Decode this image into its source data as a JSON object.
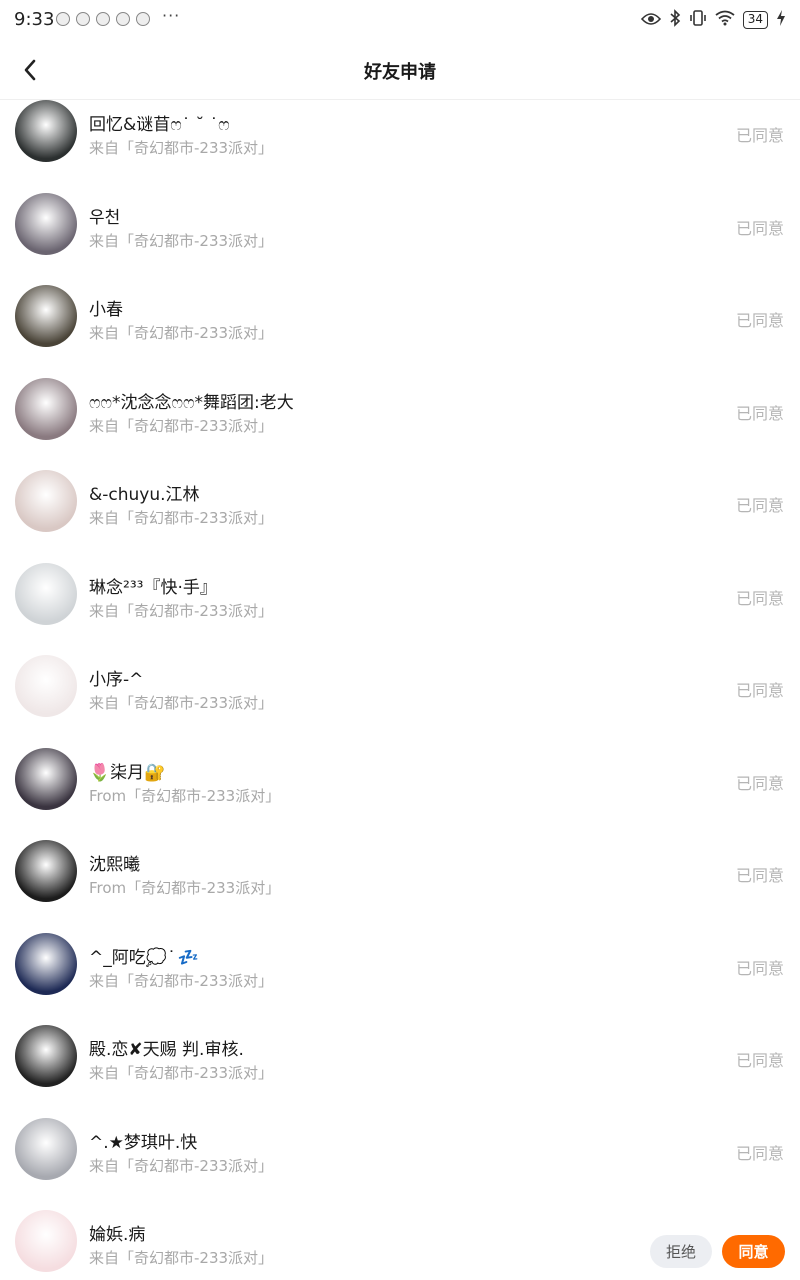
{
  "status_bar": {
    "time": "9:33",
    "more": "···",
    "battery": "34"
  },
  "header": {
    "title": "好友申请"
  },
  "requests": [
    {
      "name": "回忆&谜苜ෆ˙ ˘ ˙ෆ",
      "source": "来自「奇幻都市-233派对」",
      "status": "已同意",
      "avatar": "#2b2f2f"
    },
    {
      "name": "우천",
      "source": "来自「奇幻都市-233派对」",
      "status": "已同意",
      "avatar": "#6a6470"
    },
    {
      "name": "小春",
      "source": "来自「奇幻都市-233派对」",
      "status": "已同意",
      "avatar": "#4a4438"
    },
    {
      "name": "ෆෆ*沈念念ෆෆ*舞蹈团:老大",
      "source": "来自「奇幻都市-233派对」",
      "status": "已同意",
      "avatar": "#8a7a80"
    },
    {
      "name": "&-chuyu.江林",
      "source": "来自「奇幻都市-233派对」",
      "status": "已同意",
      "avatar": "#d9c8c4"
    },
    {
      "name": "琳念²³³『快·手』",
      "source": "来自「奇幻都市-233派对」",
      "status": "已同意",
      "avatar": "#cfd3d6"
    },
    {
      "name": "小序-^",
      "source": "来自「奇幻都市-233派对」",
      "status": "已同意",
      "avatar": "#efe7e7"
    },
    {
      "name": "🌷柒月🔐",
      "source": "From「奇幻都市-233派对」",
      "status": "已同意",
      "avatar": "#3a3440"
    },
    {
      "name": "沈熙曦",
      "source": "From「奇幻都市-233派对」",
      "status": "已同意",
      "avatar": "#1c1c1c"
    },
    {
      "name": "^_阿吃💭 ͘ 💤",
      "source": "来自「奇幻都市-233派对」",
      "status": "已同意",
      "avatar": "#1e2a55"
    },
    {
      "name": "殿.恋✘天赐 判.审核.",
      "source": "来自「奇幻都市-233派对」",
      "status": "已同意",
      "avatar": "#222222"
    },
    {
      "name": "^.★梦琪叶.快",
      "source": "来自「奇幻都市-233派对」",
      "status": "已同意",
      "avatar": "#a7a9b0"
    },
    {
      "name": "婨娦.病",
      "source": "来自「奇幻都市-233派对」",
      "status": "",
      "avatar": "#f5dde0",
      "reject_label": "拒绝",
      "accept_label": "同意"
    }
  ]
}
